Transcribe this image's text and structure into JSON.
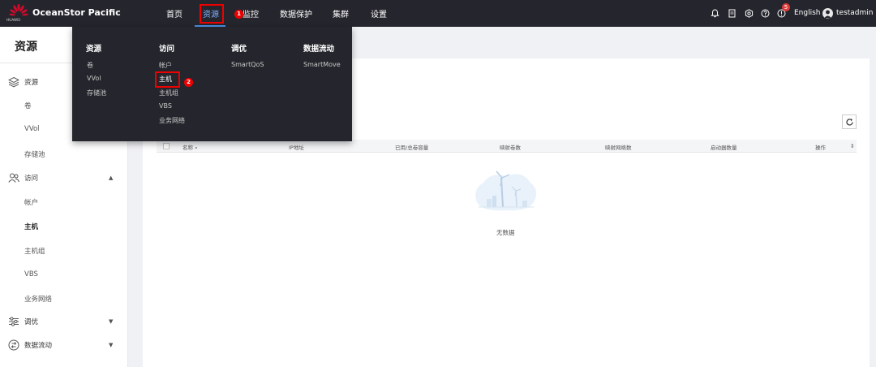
{
  "app": {
    "brand_small": "HUAWEI",
    "product_name": "OceanStor Pacific",
    "brand_color": "#cf0a2c"
  },
  "topnav": {
    "items": [
      {
        "label": "首页"
      },
      {
        "label": "资源",
        "active": true
      },
      {
        "label": "监控"
      },
      {
        "label": "数据保护"
      },
      {
        "label": "集群"
      },
      {
        "label": "设置"
      }
    ],
    "icons": [
      "bell-icon",
      "document-icon",
      "gear-icon",
      "help-icon",
      "alarm-icon"
    ],
    "alarm_count": "5",
    "language": "English",
    "username": "testadmin"
  },
  "annotations": {
    "step1": "1",
    "step2": "2"
  },
  "dropdown": {
    "columns": [
      {
        "title": "资源",
        "items": [
          "卷",
          "VVol",
          "存储池"
        ]
      },
      {
        "title": "访问",
        "items": [
          "帐户",
          "主机",
          "主机组",
          "VBS",
          "业务网络"
        ]
      },
      {
        "title": "调优",
        "items": [
          "SmartQoS"
        ]
      },
      {
        "title": "数据流动",
        "items": [
          "SmartMove"
        ]
      }
    ]
  },
  "sidebar": {
    "title": "资源",
    "groups": [
      {
        "label": "资源",
        "icon": "layers-icon",
        "items": [
          "卷",
          "VVol",
          "存储池"
        ]
      },
      {
        "label": "访问",
        "icon": "users-icon",
        "expanded": true,
        "items": [
          "帐户",
          "主机",
          "主机组",
          "VBS",
          "业务网络"
        ]
      },
      {
        "label": "调优",
        "icon": "sliders-icon",
        "expanded": false
      },
      {
        "label": "数据流动",
        "icon": "dataflow-icon",
        "expanded": false
      }
    ],
    "active_item": "主机"
  },
  "table": {
    "columns": [
      "名称",
      "IP地址",
      "已用/总卷容量",
      "映射卷数",
      "映射网络数",
      "启动器数量",
      "操作"
    ],
    "empty_text": "无数据"
  }
}
